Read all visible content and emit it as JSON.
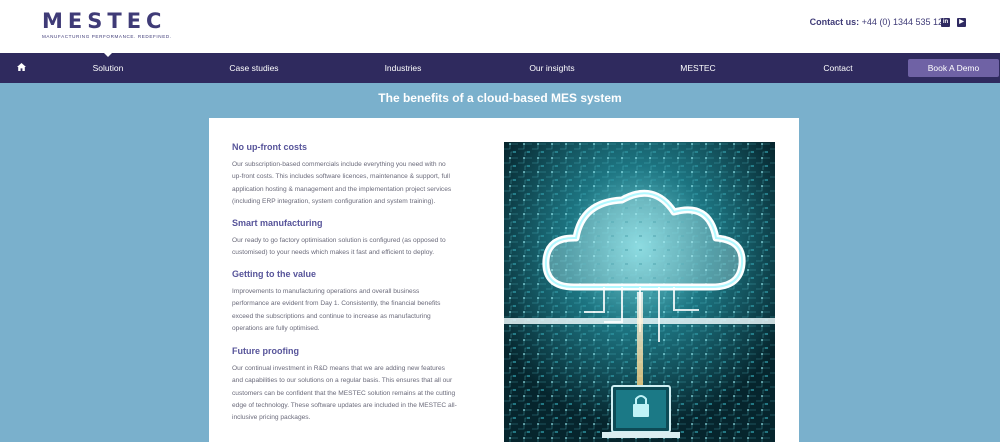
{
  "header": {
    "logo_text": "MESTEC",
    "logo_tagline": "MANUFACTURING PERFORMANCE. REDEFINED.",
    "contact_label": "Contact us:",
    "contact_phone": "+44 (0) 1344 535 120",
    "social": [
      {
        "name": "linkedin-icon",
        "glyph": "in"
      },
      {
        "name": "youtube-icon",
        "glyph": "▶"
      }
    ]
  },
  "nav": {
    "home_icon": "home-icon",
    "items": [
      "Solution",
      "Case studies",
      "Industries",
      "Our insights",
      "MESTEC",
      "Contact"
    ],
    "active": "Solution",
    "cta": "Book A Demo"
  },
  "main": {
    "title": "The benefits of a cloud-based MES system",
    "sections": [
      {
        "heading": "No up-front costs",
        "lines": [
          "Our subscription-based commercials include everything you need with no",
          "up-front costs.  This includes software licences, maintenance & support, full",
          "application hosting & management and the implementation project services",
          "(including ERP integration, system configuration and system training)."
        ]
      },
      {
        "heading": "Smart manufacturing",
        "lines": [
          "Our ready to go factory optimisation solution is configured (as opposed to",
          "customised) to your needs which makes it fast and efficient to deploy."
        ]
      },
      {
        "heading": "Getting to the value",
        "lines": [
          "Improvements to manufacturing operations and overall business",
          "performance are evident from Day 1. Consistently, the financial benefits",
          "exceed the subscriptions and continue to increase as manufacturing",
          "operations are fully optimised."
        ]
      },
      {
        "heading": "Future proofing",
        "lines": [
          "Our continual investment in R&D means that we are adding new features",
          "and capabilities to our solutions on a regular basis.  This ensures that all our",
          "customers can be confident that the MESTEC solution remains at the cutting",
          "edge of technology.  These software updates are included in the MESTEC all-",
          "inclusive pricing packages."
        ]
      }
    ],
    "image_name": "cloud-circuit-image"
  },
  "colors": {
    "brand": "#3f3b77",
    "nav_bg": "#2f2a5e",
    "cta_bg": "#6f62a5",
    "page_bg": "#7ab0cc",
    "heading": "#57549a"
  }
}
